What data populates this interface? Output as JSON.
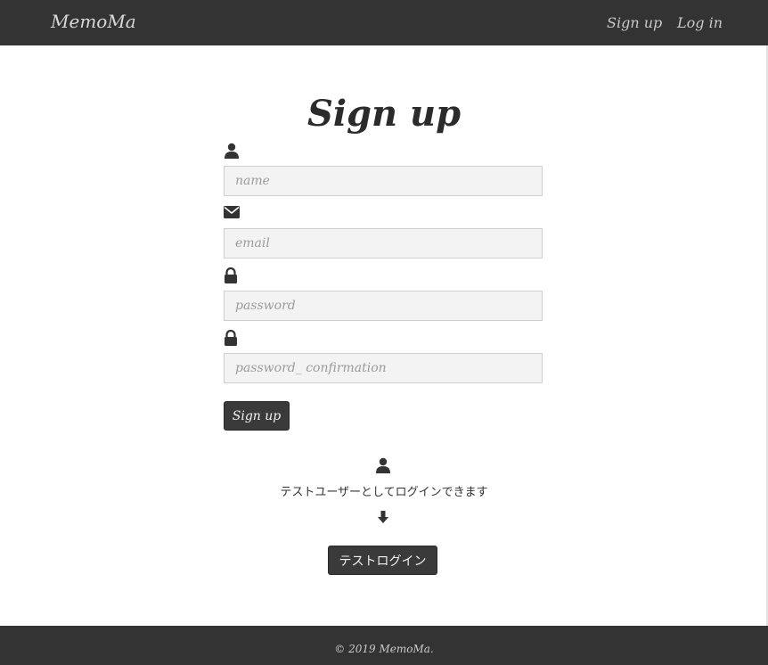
{
  "navbar": {
    "brand": "MemoMa",
    "signup_label": "Sign up",
    "login_label": "Log in"
  },
  "page": {
    "title": "Sign up"
  },
  "form": {
    "name_placeholder": "name",
    "email_placeholder": "email",
    "password_placeholder": "password",
    "password_confirmation_placeholder": "password_ confirmation",
    "submit_label": "Sign up",
    "icons": [
      "user-icon",
      "envelope-icon",
      "lock-icon",
      "lock-icon"
    ]
  },
  "test_login": {
    "icon": "user-icon",
    "message": "テストユーザーとしてログインできます",
    "arrow_icon": "arrow-down-icon",
    "button_label": "テストログイン"
  },
  "footer": {
    "copyright": "© 2019 MemoMa."
  },
  "colors": {
    "navbar_bg": "#333333",
    "button_bg": "#3a3a3a",
    "input_bg": "#f3f3f3"
  }
}
